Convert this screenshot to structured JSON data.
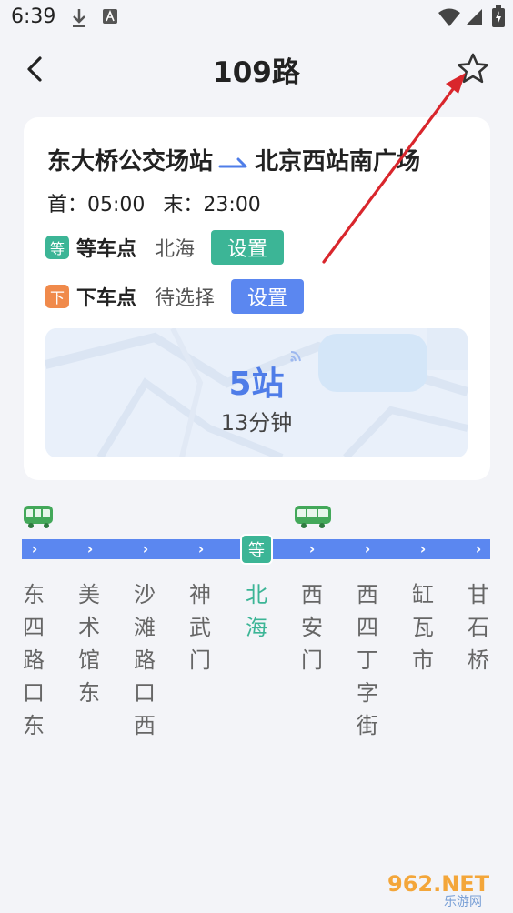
{
  "status_bar": {
    "time": "6:39"
  },
  "header": {
    "title": "109路"
  },
  "route": {
    "origin": "东大桥公交场站",
    "destination": "北京西站南广场",
    "first_bus": "首：05:00",
    "last_bus": "末：23:00"
  },
  "boarding": {
    "tag": "等",
    "label": "等车点",
    "value": "北海",
    "button": "设置"
  },
  "alighting": {
    "tag": "下",
    "label": "下车点",
    "value": "待选择",
    "button": "设置"
  },
  "trip": {
    "stops": "5站",
    "duration": "13分钟"
  },
  "line": {
    "current_badge": "等",
    "stations": [
      {
        "name": "东四路口东",
        "current": false
      },
      {
        "name": "美术馆东",
        "current": false
      },
      {
        "name": "沙滩路口西",
        "current": false
      },
      {
        "name": "神武门",
        "current": false
      },
      {
        "name": "北海",
        "current": true
      },
      {
        "name": "西安门",
        "current": false
      },
      {
        "name": "西四丁字街",
        "current": false
      },
      {
        "name": "缸瓦市",
        "current": false
      },
      {
        "name": "甘石桥",
        "current": false
      }
    ]
  },
  "watermark": {
    "brand": "962.NET",
    "sub": "乐游网"
  },
  "colors": {
    "accent_blue": "#5b87f0",
    "accent_green": "#3cb596",
    "accent_orange": "#f08a4b",
    "annotation_red": "#d9262c"
  }
}
